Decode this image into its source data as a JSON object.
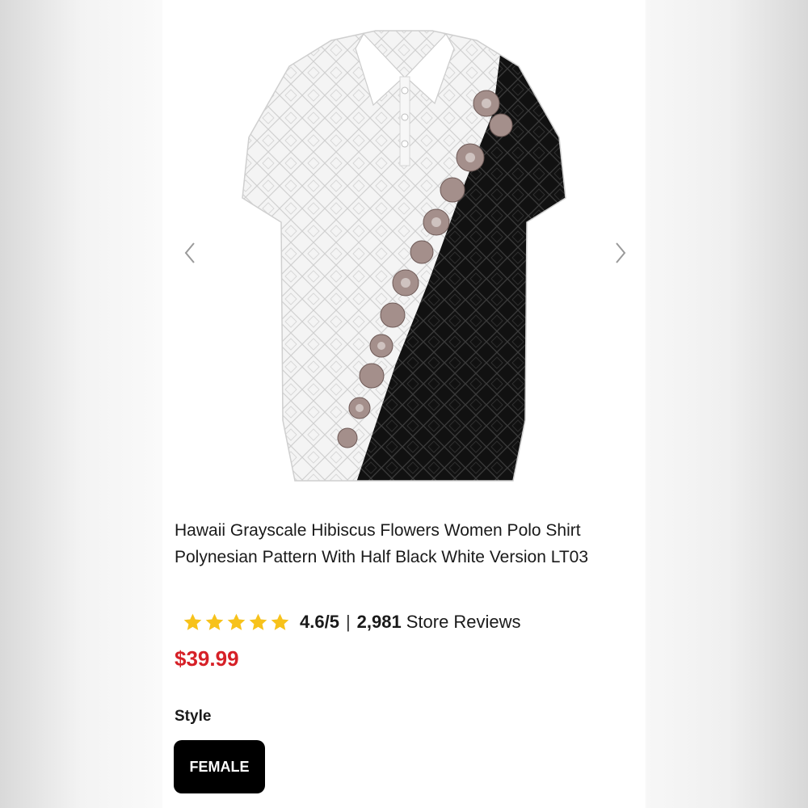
{
  "gallery": {
    "image_alt": "Hawaii Grayscale Hibiscus Flowers Women Polo Shirt"
  },
  "product": {
    "title": "Hawaii Grayscale Hibiscus Flowers Women Polo Shirt Polynesian Pattern With Half Black White Version LT03",
    "rating_value": "4.6/5",
    "rating_separator": "|",
    "review_count": "2,981",
    "review_label": "Store Reviews",
    "price": "$39.99",
    "stars": 5
  },
  "style": {
    "label": "Style",
    "selected": "FEMALE"
  },
  "colors": {
    "price": "#d62027",
    "star": "#f7c21b",
    "button_bg": "#000000"
  }
}
